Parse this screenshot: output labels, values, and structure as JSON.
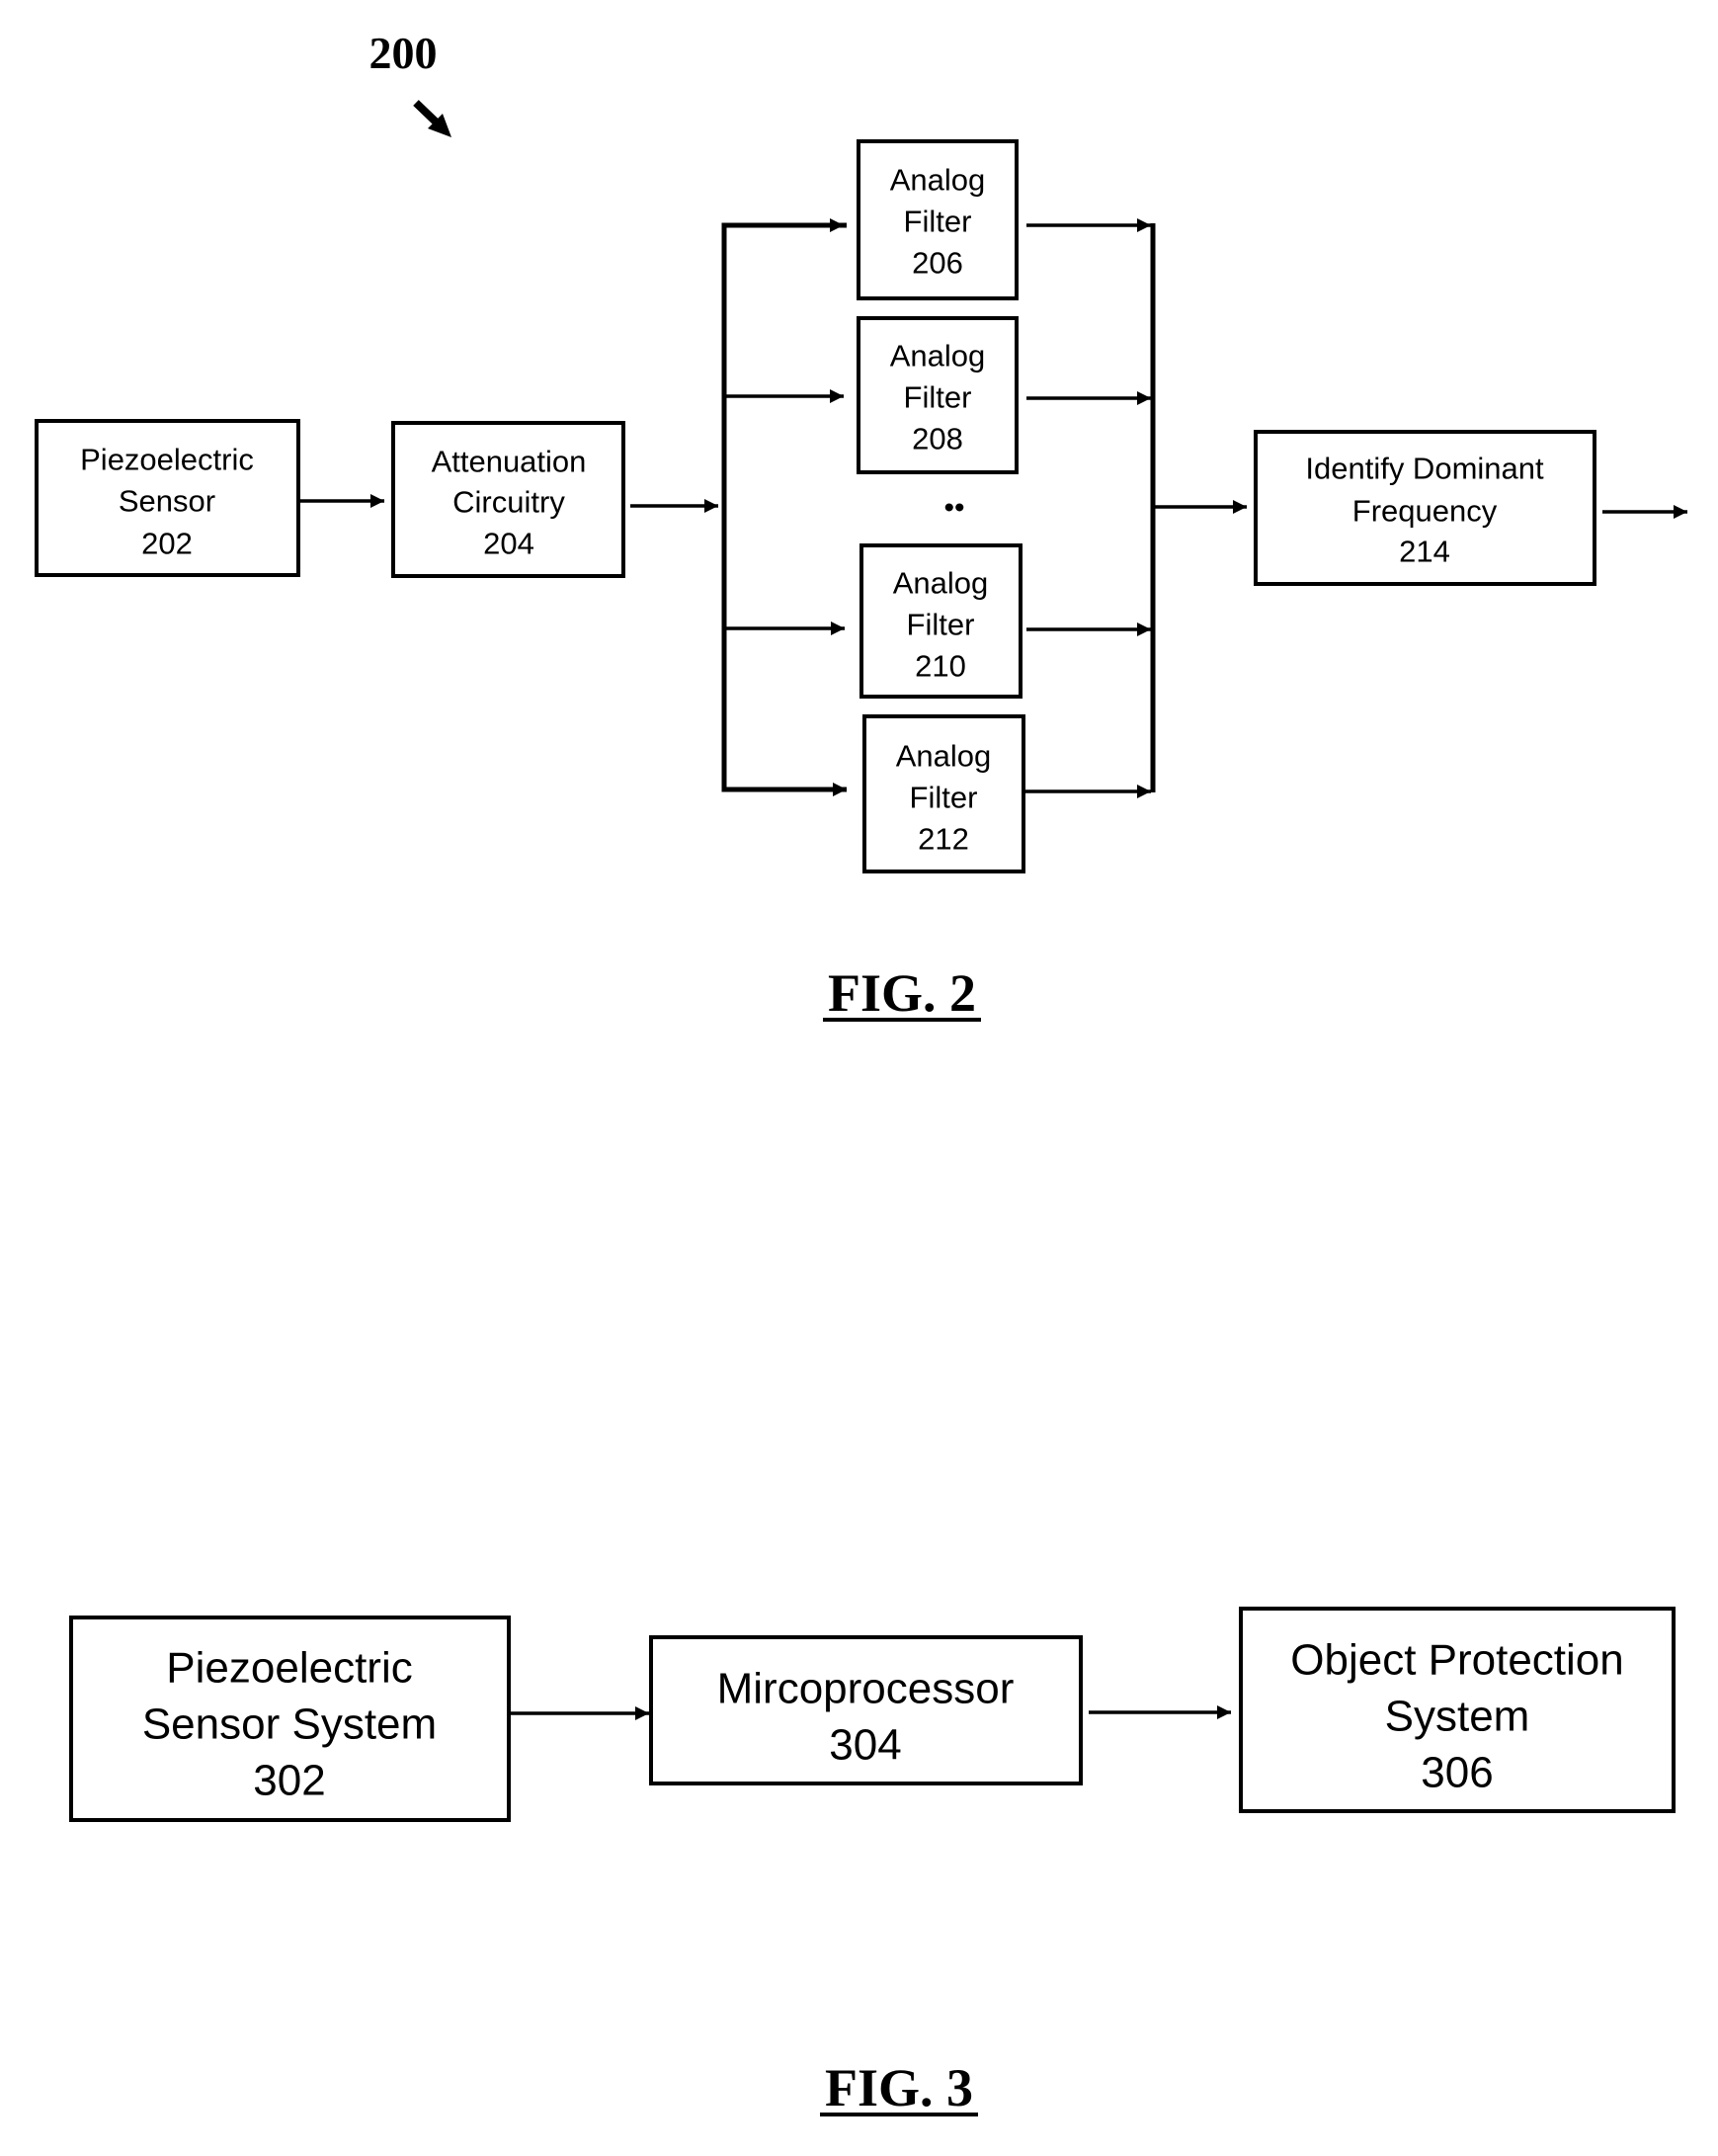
{
  "figure2": {
    "reference_numeral": "200",
    "caption": "FIG. 2",
    "blocks": {
      "sensor": {
        "lines": [
          "Piezoelectric",
          "Sensor",
          "202"
        ]
      },
      "attenuation": {
        "lines": [
          "Attenuation",
          "Circuitry",
          "204"
        ]
      },
      "filter206": {
        "lines": [
          "Analog",
          "Filter",
          "206"
        ]
      },
      "filter208": {
        "lines": [
          "Analog",
          "Filter",
          "208"
        ]
      },
      "filter210": {
        "lines": [
          "Analog",
          "Filter",
          "210"
        ]
      },
      "filter212": {
        "lines": [
          "Analog",
          "Filter",
          "212"
        ]
      },
      "dominant": {
        "lines": [
          "Identify Dominant",
          "Frequency",
          "214"
        ]
      }
    },
    "ellipsis": "••"
  },
  "figure3": {
    "caption": "FIG. 3",
    "blocks": {
      "sensor_system": {
        "lines": [
          "Piezoelectric",
          "Sensor System",
          "302"
        ]
      },
      "microprocessor": {
        "lines": [
          "Mircoprocessor",
          "304"
        ]
      },
      "protection": {
        "lines": [
          "Object Protection",
          "System",
          "306"
        ]
      }
    }
  }
}
